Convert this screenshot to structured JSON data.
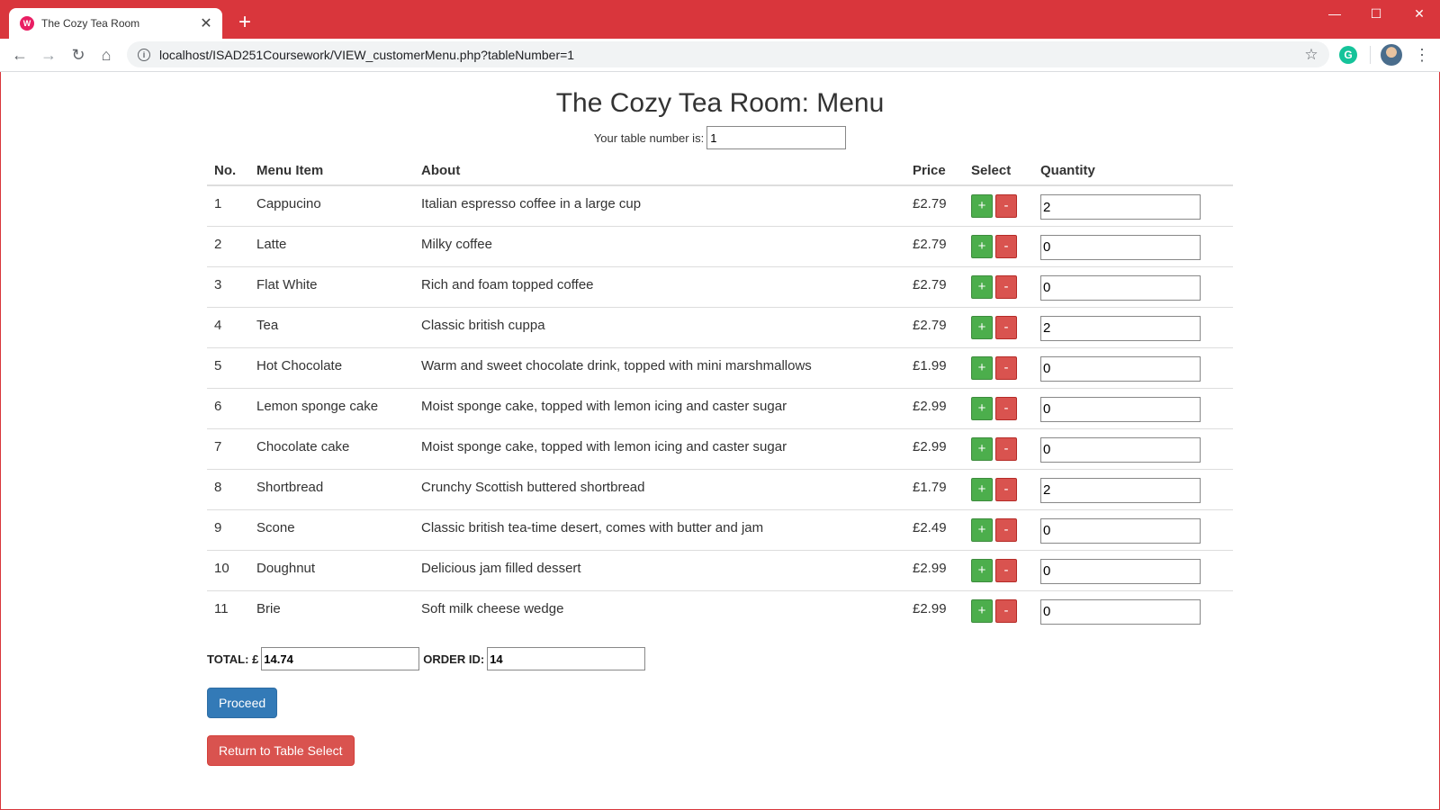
{
  "browser": {
    "tab_title": "The Cozy Tea Room",
    "url": "localhost/ISAD251Coursework/VIEW_customerMenu.php?tableNumber=1"
  },
  "page": {
    "title": "The Cozy Tea Room: Menu",
    "table_number_label": "Your table number is:",
    "table_number_value": "1"
  },
  "menu": {
    "headers": {
      "no": "No.",
      "item": "Menu Item",
      "about": "About",
      "price": "Price",
      "select": "Select",
      "quantity": "Quantity"
    },
    "plus_label": "+",
    "minus_label": "-",
    "rows": [
      {
        "no": "1",
        "item": "Cappucino",
        "about": "Italian espresso coffee in a large cup",
        "price": "£2.79",
        "qty": "2"
      },
      {
        "no": "2",
        "item": "Latte",
        "about": "Milky coffee",
        "price": "£2.79",
        "qty": "0"
      },
      {
        "no": "3",
        "item": "Flat White",
        "about": "Rich and foam topped coffee",
        "price": "£2.79",
        "qty": "0"
      },
      {
        "no": "4",
        "item": "Tea",
        "about": "Classic british cuppa",
        "price": "£2.79",
        "qty": "2"
      },
      {
        "no": "5",
        "item": "Hot Chocolate",
        "about": "Warm and sweet chocolate drink, topped with mini marshmallows",
        "price": "£1.99",
        "qty": "0"
      },
      {
        "no": "6",
        "item": "Lemon sponge cake",
        "about": "Moist sponge cake, topped with lemon icing and caster sugar",
        "price": "£2.99",
        "qty": "0"
      },
      {
        "no": "7",
        "item": "Chocolate cake",
        "about": "Moist sponge cake, topped with lemon icing and caster sugar",
        "price": "£2.99",
        "qty": "0"
      },
      {
        "no": "8",
        "item": "Shortbread",
        "about": "Crunchy Scottish buttered shortbread",
        "price": "£1.79",
        "qty": "2"
      },
      {
        "no": "9",
        "item": "Scone",
        "about": "Classic british tea-time desert, comes with butter and jam",
        "price": "£2.49",
        "qty": "0"
      },
      {
        "no": "10",
        "item": "Doughnut",
        "about": "Delicious jam filled dessert",
        "price": "£2.99",
        "qty": "0"
      },
      {
        "no": "11",
        "item": "Brie",
        "about": "Soft milk cheese wedge",
        "price": "£2.99",
        "qty": "0"
      }
    ]
  },
  "summary": {
    "total_label": "TOTAL: £",
    "total_value": "14.74",
    "order_label": "ORDER ID:",
    "order_value": "14"
  },
  "buttons": {
    "proceed": "Proceed",
    "return": "Return to Table Select"
  },
  "colors": {
    "chrome_accent": "#d9363c",
    "plus_button": "#4cae4c",
    "minus_button": "#d9534f",
    "proceed_button": "#337ab7",
    "return_button": "#d9534f"
  }
}
